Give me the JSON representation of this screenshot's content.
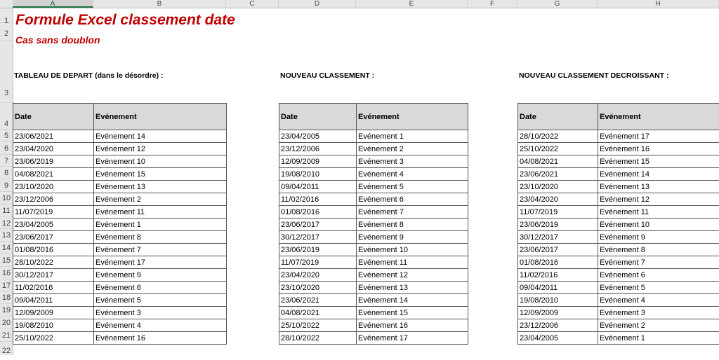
{
  "columns": [
    "A",
    "B",
    "C",
    "D",
    "E",
    "F",
    "G",
    "H"
  ],
  "rows": [
    "1",
    "2",
    "3",
    "4",
    "5",
    "6",
    "7",
    "8",
    "9",
    "10",
    "11",
    "12",
    "13",
    "14",
    "15",
    "16",
    "17",
    "18",
    "19",
    "20",
    "21",
    "22"
  ],
  "title": "Formule Excel classement date",
  "subtitle": "Cas sans doublon",
  "tables": [
    {
      "heading": "TABLEAU DE DEPART (dans le désordre) :",
      "headers": [
        "Date",
        "Evénement"
      ],
      "rows": [
        [
          "23/06/2021",
          "Evénement 14"
        ],
        [
          "23/04/2020",
          "Evénement 12"
        ],
        [
          "23/06/2019",
          "Evénement 10"
        ],
        [
          "04/08/2021",
          "Evénement 15"
        ],
        [
          "23/10/2020",
          "Evénement 13"
        ],
        [
          "23/12/2006",
          "Evénement 2"
        ],
        [
          "11/07/2019",
          "Evénement 11"
        ],
        [
          "23/04/2005",
          "Evénement 1"
        ],
        [
          "23/06/2017",
          "Evénement 8"
        ],
        [
          "01/08/2016",
          "Evénement 7"
        ],
        [
          "28/10/2022",
          "Evénement 17"
        ],
        [
          "30/12/2017",
          "Evénement 9"
        ],
        [
          "11/02/2016",
          "Evénement 6"
        ],
        [
          "09/04/2011",
          "Evénement 5"
        ],
        [
          "12/09/2009",
          "Evénement 3"
        ],
        [
          "19/08/2010",
          "Evénement 4"
        ],
        [
          "25/10/2022",
          "Evénement 16"
        ]
      ]
    },
    {
      "heading": "NOUVEAU CLASSEMENT :",
      "headers": [
        "Date",
        "Evénement"
      ],
      "rows": [
        [
          "23/04/2005",
          "Evénement 1"
        ],
        [
          "23/12/2006",
          "Evénement 2"
        ],
        [
          "12/09/2009",
          "Evénement 3"
        ],
        [
          "19/08/2010",
          "Evénement 4"
        ],
        [
          "09/04/2011",
          "Evénement 5"
        ],
        [
          "11/02/2016",
          "Evénement 6"
        ],
        [
          "01/08/2016",
          "Evénement 7"
        ],
        [
          "23/06/2017",
          "Evénement 8"
        ],
        [
          "30/12/2017",
          "Evénement 9"
        ],
        [
          "23/06/2019",
          "Evénement 10"
        ],
        [
          "11/07/2019",
          "Evénement 11"
        ],
        [
          "23/04/2020",
          "Evénement 12"
        ],
        [
          "23/10/2020",
          "Evénement 13"
        ],
        [
          "23/06/2021",
          "Evénement 14"
        ],
        [
          "04/08/2021",
          "Evénement 15"
        ],
        [
          "25/10/2022",
          "Evénement 16"
        ],
        [
          "28/10/2022",
          "Evénement 17"
        ]
      ]
    },
    {
      "heading": "NOUVEAU CLASSEMENT DECROISSANT :",
      "headers": [
        "Date",
        "Evénement"
      ],
      "rows": [
        [
          "28/10/2022",
          "Evénement 17"
        ],
        [
          "25/10/2022",
          "Evénement 16"
        ],
        [
          "04/08/2021",
          "Evénement 15"
        ],
        [
          "23/06/2021",
          "Evénement 14"
        ],
        [
          "23/10/2020",
          "Evénement 13"
        ],
        [
          "23/04/2020",
          "Evénement 12"
        ],
        [
          "11/07/2019",
          "Evénement 11"
        ],
        [
          "23/06/2019",
          "Evénement 10"
        ],
        [
          "30/12/2017",
          "Evénement 9"
        ],
        [
          "23/06/2017",
          "Evénement 8"
        ],
        [
          "01/08/2016",
          "Evénement 7"
        ],
        [
          "11/02/2016",
          "Evénement 6"
        ],
        [
          "09/04/2011",
          "Evénement 5"
        ],
        [
          "19/08/2010",
          "Evénement 4"
        ],
        [
          "12/09/2009",
          "Evénement 3"
        ],
        [
          "23/12/2006",
          "Evénement 2"
        ],
        [
          "23/04/2005",
          "Evénement 1"
        ]
      ]
    }
  ]
}
